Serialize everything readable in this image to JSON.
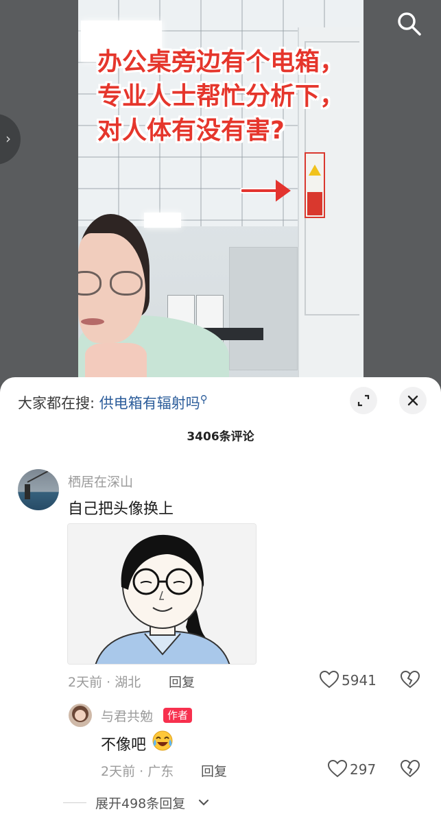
{
  "video": {
    "caption": "办公桌旁边有个电箱，专业人士帮忙分析下，对人体有没有害?"
  },
  "search_suggestion": {
    "label": "大家都在搜:",
    "term": "供电箱有辐射吗"
  },
  "comments_header": {
    "count_text": "3406条评论"
  },
  "comments": [
    {
      "username": "栖居在深山",
      "text": "自己把头像换上",
      "time": "2天前",
      "location": "湖北",
      "reply_label": "回复",
      "likes": "5941"
    }
  ],
  "reply": {
    "username": "与君共勉",
    "badge": "作者",
    "text": "不像吧",
    "time": "2天前",
    "location": "广东",
    "reply_label": "回复",
    "likes": "297"
  },
  "expand_replies": "展开498条回复",
  "colors": {
    "caption_red": "#e5362c",
    "search_term_blue": "#2b5c9a",
    "author_badge": "#f7304e"
  },
  "icons": [
    "search-icon",
    "chevron-right-icon",
    "expand-icon",
    "close-icon",
    "heart-icon",
    "broken-heart-icon",
    "laughing-crying-emoji",
    "chevron-down-icon"
  ]
}
